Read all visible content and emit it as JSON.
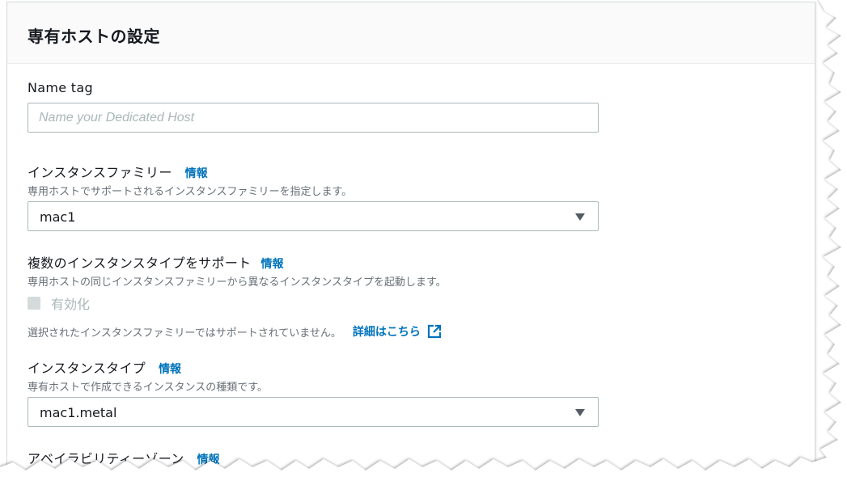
{
  "panel": {
    "title": "専有ホストの設定"
  },
  "name_tag": {
    "label": "Name tag",
    "placeholder": "Name your Dedicated Host",
    "value": ""
  },
  "instance_family": {
    "label": "インスタンスファミリー",
    "info": "情報",
    "description": "専用ホストでサポートされるインスタンスファミリーを指定します。",
    "selected": "mac1"
  },
  "multi_instance_type": {
    "label": "複数のインスタンスタイプをサポート",
    "info": "情報",
    "description": "専用ホストの同じインスタンスファミリーから異なるインスタンスタイプを起動します。",
    "checkbox_label": "有効化",
    "checked": false,
    "disabled": true,
    "note": "選択されたインスタンスファミリーではサポートされていません。",
    "learn_more": "詳細はこちら",
    "learn_more_icon": "external-link-icon"
  },
  "instance_type": {
    "label": "インスタンスタイプ",
    "info": "情報",
    "description": "専有ホストで作成できるインスタンスの種類です。",
    "selected": "mac1.metal"
  },
  "availability_zone": {
    "label": "アベイラビリティーゾーン",
    "info": "情報"
  },
  "colors": {
    "link": "#0073bb",
    "text": "#16191f",
    "muted": "#687078",
    "border": "#aab7b8",
    "disabled": "#d5dbdb"
  }
}
